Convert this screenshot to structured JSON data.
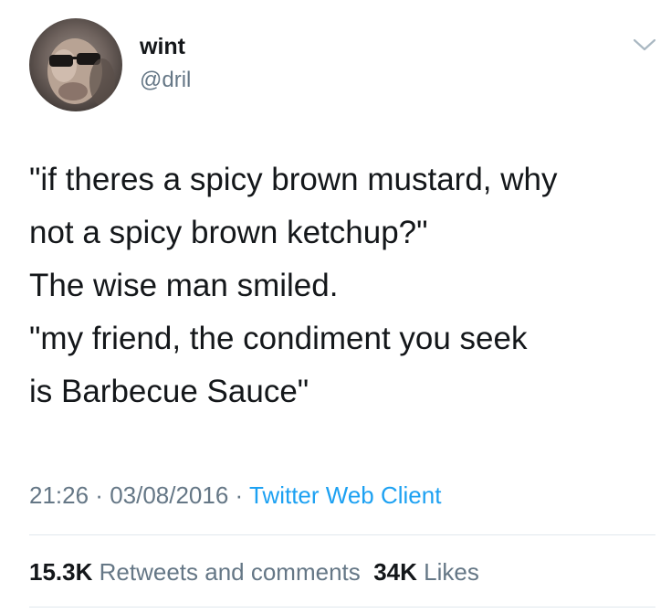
{
  "author": {
    "display_name": "wint",
    "handle": "@dril",
    "avatar_icon": "user-avatar"
  },
  "menu_icon": "chevron-down-icon",
  "tweet": {
    "lines": [
      "\"if theres a spicy brown mustard, why",
      "not a spicy brown ketchup?\"",
      "The wise man smiled.",
      "\"my friend, the condiment you seek",
      "is Barbecue Sauce\""
    ]
  },
  "meta": {
    "time": "21:26",
    "sep1": " · ",
    "date": "03/08/2016",
    "sep2": " · ",
    "client": "Twitter Web Client"
  },
  "stats": {
    "retweets_count": "15.3K",
    "retweets_label": "Retweets and comments",
    "likes_count": "34K",
    "likes_label": "Likes"
  },
  "colors": {
    "text": "#14171a",
    "secondary": "#657786",
    "link": "#1da1f2",
    "divider": "#e1e8ed"
  }
}
